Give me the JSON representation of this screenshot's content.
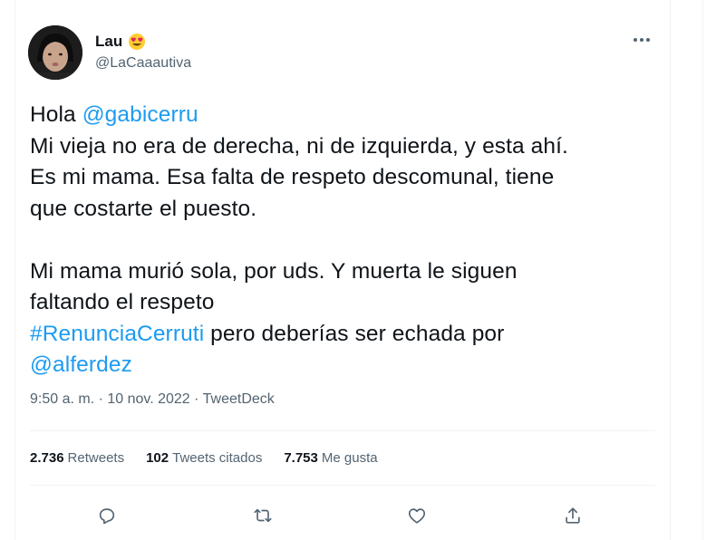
{
  "user": {
    "name": "Lau",
    "name_emoji": "smiling-face-with-heart-eyes",
    "handle": "@LaCaaautiva"
  },
  "tweet": {
    "lines": [
      [
        {
          "text": "Hola "
        },
        {
          "text": "@gabicerru",
          "link": true
        }
      ],
      [
        {
          "text": "Mi vieja no era de derecha, ni de izquierda, y esta ahí."
        }
      ],
      [
        {
          "text": "Es mi mama. Esa falta de respeto descomunal, tiene"
        }
      ],
      [
        {
          "text": "que costarte el puesto."
        }
      ],
      [
        {
          "text": ""
        }
      ],
      [
        {
          "text": "Mi mama murió sola, por uds. Y muerta le siguen"
        }
      ],
      [
        {
          "text": "faltando el respeto"
        }
      ],
      [
        {
          "text": "#RenunciaCerruti",
          "link": true
        },
        {
          "text": " pero deberías ser echada por"
        }
      ],
      [
        {
          "text": "@alferdez",
          "link": true
        }
      ]
    ],
    "timestamp": "9:50 a. m. · 10 nov. 2022 · TweetDeck"
  },
  "stats": {
    "retweets_count": "2.736",
    "retweets_label": "Retweets",
    "quotes_count": "102",
    "quotes_label": "Tweets citados",
    "likes_count": "7.753",
    "likes_label": "Me gusta"
  },
  "actions": [
    "reply-icon",
    "retweet-icon",
    "like-icon",
    "share-icon"
  ],
  "colors": {
    "link": "#1d9bf0",
    "secondary": "#536471",
    "text": "#0f1419",
    "border": "#eff3f4"
  }
}
